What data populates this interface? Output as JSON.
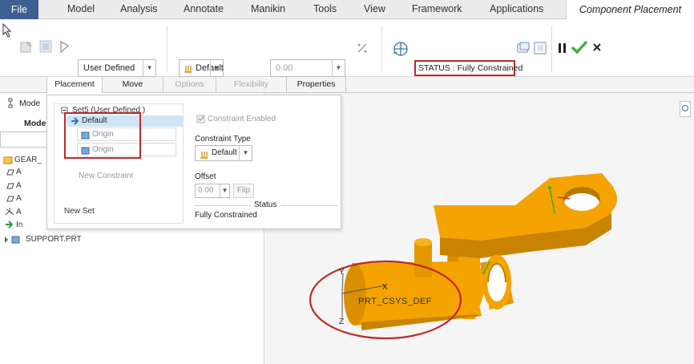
{
  "menubar": {
    "items": [
      "File",
      "Model",
      "Analysis",
      "Annotate",
      "Manikin",
      "Tools",
      "View",
      "Framework",
      "Applications"
    ],
    "active_tab": "Component Placement"
  },
  "ribbon": {
    "placement_type": "User Defined",
    "constraint_type": "Default",
    "offset_value": "0.00",
    "status": "STATUS : Fully Constrained"
  },
  "tabs": {
    "items": [
      "Placement",
      "Move",
      "Options",
      "Flexibility",
      "Properties"
    ]
  },
  "popup": {
    "set_name": "Set5 (User Defined )",
    "constraint_selected": "Default",
    "ref1": "Origin",
    "ref2": "Origin",
    "new_constraint": "New Constraint",
    "new_set": "New Set",
    "constraint_enabled_label": "Constraint Enabled",
    "constraint_type_label": "Constraint Type",
    "constraint_type_value": "Default",
    "offset_label": "Offset",
    "offset_value": "0.00",
    "flip_label": "Flip",
    "status_label": "Status",
    "status_value": "Fully Constrained"
  },
  "left_panel": {
    "model_tree_label": "Mode",
    "model_heading": "Model",
    "tree_items": [
      "GEAR_",
      "A",
      "A",
      "A",
      "A",
      "In"
    ],
    "support_item": "SUPPORT.PRT"
  },
  "viewport": {
    "csys_label": "PRT_CSYS_DEF",
    "axis_x": "X",
    "axis_y": "Y",
    "axis_z": "Z"
  },
  "colors": {
    "part": "#f5a300",
    "part_dark": "#c98300",
    "highlight": "#c0282b",
    "selection": "#cfe4f7",
    "file_tab": "#3d5f91",
    "ok_green": "#3fae3f"
  }
}
